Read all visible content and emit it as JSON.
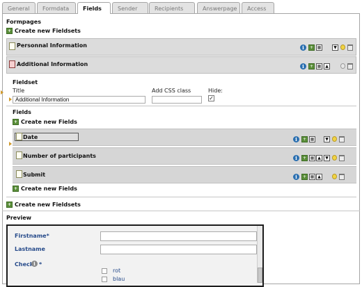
{
  "tabs": [
    {
      "label": "General",
      "active": false
    },
    {
      "label": "Formdata",
      "active": false
    },
    {
      "label": "Fields",
      "active": true
    },
    {
      "label": "Sender",
      "active": false
    },
    {
      "label": "Recipients",
      "active": false
    },
    {
      "label": "Answerpage",
      "active": false
    },
    {
      "label": "Access",
      "active": false
    }
  ],
  "formpages_header": "Formpages",
  "create_fieldsets_label": "Create new Fieldsets",
  "fieldsets": [
    {
      "title": "Personnal Information"
    },
    {
      "title": "Additional Information"
    }
  ],
  "fieldset_edit": {
    "header": "Fieldset",
    "title_label": "Title",
    "title_value": "Additional Information",
    "css_label": "Add CSS class",
    "css_value": "",
    "hide_label": "Hide:",
    "hide_checked": true
  },
  "fields_header": "Fields",
  "create_fields_label": "Create new Fields",
  "fields": [
    {
      "title": "Date"
    },
    {
      "title": "Number of participants"
    },
    {
      "title": "Submit"
    }
  ],
  "preview": {
    "header": "Preview",
    "firstname_label": "Firstname*",
    "lastname_label": "Lastname",
    "check_label": "Check",
    "check_required": "*",
    "options": [
      "rot",
      "blau"
    ]
  },
  "icons": {
    "info": "i",
    "grid": "▦",
    "move_up": "▲",
    "move_down": "▼"
  }
}
